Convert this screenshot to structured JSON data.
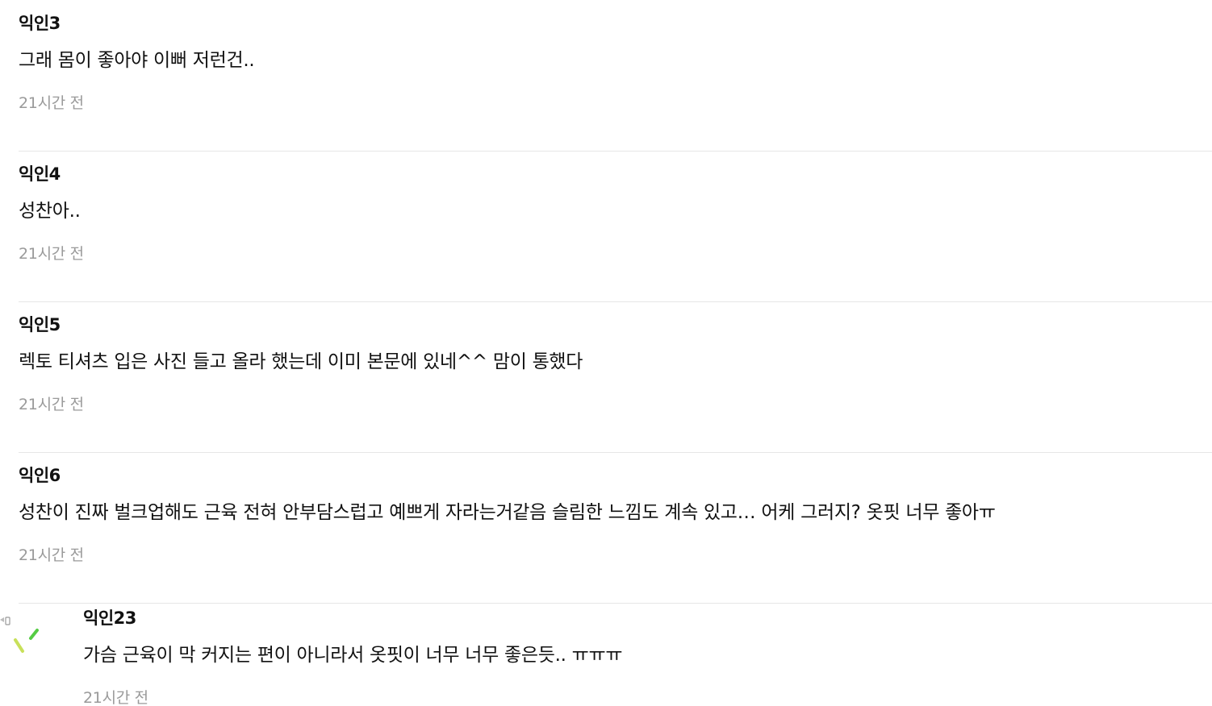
{
  "comments": [
    {
      "author": "익인3",
      "body": "그래 몸이 좋아야 이뻐 저런건..",
      "time": "21시간 전"
    },
    {
      "author": "익인4",
      "body": "성찬아..",
      "time": "21시간 전"
    },
    {
      "author": "익인5",
      "body": "렉토 티셔츠 입은 사진 들고 올라 했는데 이미 본문에 있네^^ 맘이 통했다",
      "time": "21시간 전"
    },
    {
      "author": "익인6",
      "body": "성찬이 진짜 벌크업해도 근육 전혀 안부담스럽고 예쁘게 자라는거같음 슬림한 느낌도 계속 있고… 어케 그러지? 옷핏 너무 좋아ㅠ",
      "time": "21시간 전"
    }
  ],
  "reply": {
    "icon": "reply-arrow-icon",
    "author": "익인23",
    "body": "가슴 근육이 막 커지는 편이 아니라서 옷핏이 너무 너무 좋은듯.. ㅠㅠㅠ",
    "time": "21시간 전"
  }
}
